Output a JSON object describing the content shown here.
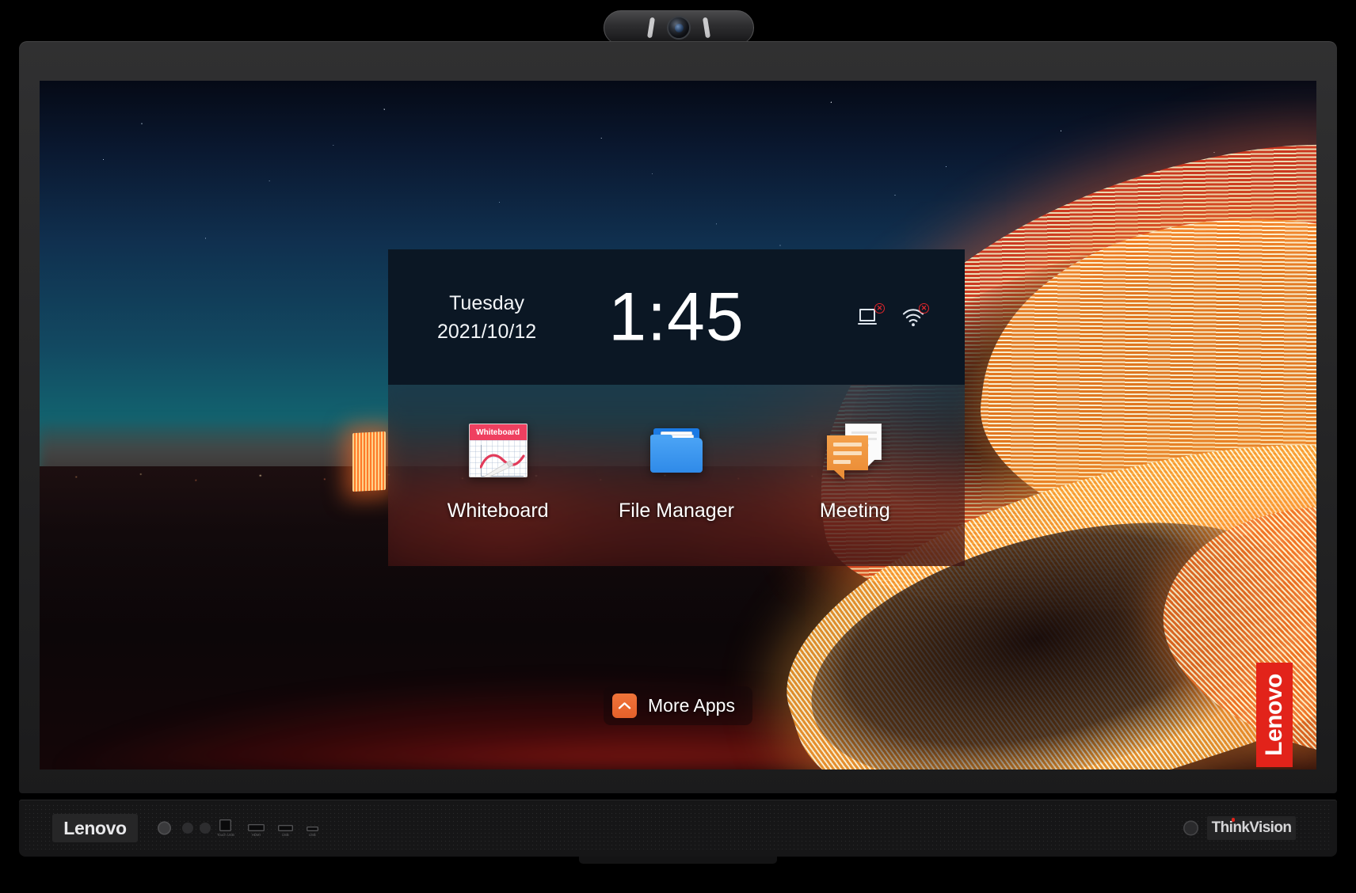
{
  "device": {
    "brand_left": "Lenovo",
    "brand_right": "ThinkVision",
    "wallpaper_watermark": "Lenovo",
    "ports": [
      {
        "name": "Touch USB",
        "label": "Touch USB",
        "icon": "usb-b-port-icon"
      },
      {
        "name": "HDMI",
        "label": "HDMI",
        "icon": "hdmi-port-icon"
      },
      {
        "name": "USB 1",
        "label": "USB",
        "icon": "usb-a-port-icon"
      },
      {
        "name": "USB 2",
        "label": "USB",
        "icon": "usb-a-port-icon"
      }
    ],
    "webcam": {
      "name": "webcam-module"
    }
  },
  "panel": {
    "clock": "1:45",
    "day_of_week": "Tuesday",
    "date": "2021/10/12",
    "status_icons": [
      {
        "name": "screen-share-icon",
        "badge": "x",
        "state": "disconnected"
      },
      {
        "name": "wifi-icon",
        "badge": "x",
        "state": "disconnected"
      }
    ]
  },
  "apps": [
    {
      "label": "Whiteboard",
      "icon": "whiteboard-icon",
      "tile_title": "Whiteboard"
    },
    {
      "label": "File Manager",
      "icon": "file-manager-icon"
    },
    {
      "label": "Meeting",
      "icon": "meeting-icon"
    }
  ],
  "more_apps": {
    "label": "More Apps",
    "icon": "chevron-up-icon"
  },
  "colors": {
    "panel_bg": "#0b1724",
    "accent_orange": "#e4602a",
    "brand_red": "#e2231a",
    "whiteboard_pink": "#ef4060",
    "folder_blue": "#2f8ae8",
    "meeting_orange": "#ec8f38",
    "badge_red": "#e0262b"
  }
}
